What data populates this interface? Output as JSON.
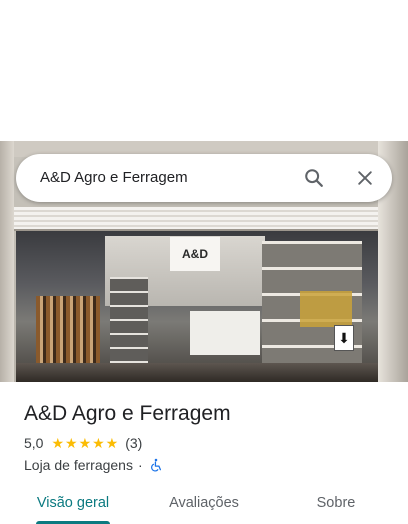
{
  "search": {
    "query": "A&D Agro e Ferragem"
  },
  "photo": {
    "store_sign_text": "A&D",
    "floor_sign_text": "⬇"
  },
  "place": {
    "name": "A&D Agro e Ferragem",
    "rating": "5,0",
    "stars": "★★★★★",
    "review_count": "(3)",
    "category": "Loja de ferragens",
    "separator": "·"
  },
  "tabs": [
    {
      "label": "Visão geral",
      "active": true
    },
    {
      "label": "Avaliações",
      "active": false
    },
    {
      "label": "Sobre",
      "active": false
    }
  ],
  "icons": {
    "search": "search-icon",
    "close": "close-icon",
    "accessibility": "wheelchair-icon"
  },
  "colors": {
    "accent": "#0b7a80",
    "star": "#fbbc04",
    "accessibility": "#1a73e8"
  }
}
